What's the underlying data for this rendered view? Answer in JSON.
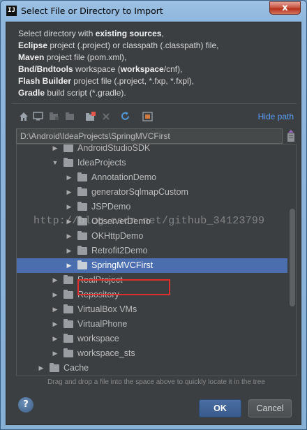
{
  "window": {
    "title": "Select File or Directory to Import",
    "app_icon_text": "IJ",
    "close_symbol": "x"
  },
  "description": {
    "lines": [
      {
        "parts": [
          {
            "t": "Select directory with ",
            "b": false
          },
          {
            "t": "existing sources",
            "b": true
          },
          {
            "t": ",",
            "b": false
          }
        ]
      },
      {
        "parts": [
          {
            "t": "Eclipse",
            "b": true
          },
          {
            "t": " project (.project) or classpath (.classpath) file,",
            "b": false
          }
        ]
      },
      {
        "parts": [
          {
            "t": "Maven",
            "b": true
          },
          {
            "t": " project file (pom.xml),",
            "b": false
          }
        ]
      },
      {
        "parts": [
          {
            "t": "Bnd/Bndtools",
            "b": true
          },
          {
            "t": " workspace (",
            "b": false
          },
          {
            "t": "workspace",
            "b": true
          },
          {
            "t": "/cnf),",
            "b": false
          }
        ]
      },
      {
        "parts": [
          {
            "t": "Flash Builder",
            "b": true
          },
          {
            "t": " project file (.project, *.fxp, *.fxpl),",
            "b": false
          }
        ]
      },
      {
        "parts": [
          {
            "t": "Gradle",
            "b": true
          },
          {
            "t": " build script (*.gradle).",
            "b": false
          }
        ]
      }
    ]
  },
  "toolbar": {
    "icons": [
      "home-icon",
      "desktop-icon",
      "project-icon",
      "module-icon",
      "new-folder-icon",
      "delete-icon",
      "refresh-icon",
      "show-hidden-icon"
    ],
    "hide_path_label": "Hide path"
  },
  "path": {
    "value": "D:\\Android\\IdeaProjects\\SpringMVCFirst"
  },
  "tree": {
    "items": [
      {
        "label": "AndroidStudioSDK",
        "depth": 1,
        "expanded": false,
        "selected": false
      },
      {
        "label": "IdeaProjects",
        "depth": 1,
        "expanded": true,
        "selected": false
      },
      {
        "label": "AnnotationDemo",
        "depth": 2,
        "expanded": false,
        "selected": false
      },
      {
        "label": "generatorSqlmapCustom",
        "depth": 2,
        "expanded": false,
        "selected": false
      },
      {
        "label": "JSPDemo",
        "depth": 2,
        "expanded": false,
        "selected": false
      },
      {
        "label": "ObserverDemo",
        "depth": 2,
        "expanded": false,
        "selected": false
      },
      {
        "label": "OKHttpDemo",
        "depth": 2,
        "expanded": false,
        "selected": false
      },
      {
        "label": "Retrofit2Demo",
        "depth": 2,
        "expanded": false,
        "selected": false
      },
      {
        "label": "SpringMVCFirst",
        "depth": 2,
        "expanded": false,
        "selected": true
      },
      {
        "label": "RealProject",
        "depth": 1,
        "expanded": false,
        "selected": false
      },
      {
        "label": "Repository",
        "depth": 1,
        "expanded": false,
        "selected": false
      },
      {
        "label": "VirtualBox VMs",
        "depth": 1,
        "expanded": false,
        "selected": false
      },
      {
        "label": "VirtualPhone",
        "depth": 1,
        "expanded": false,
        "selected": false
      },
      {
        "label": "workspace",
        "depth": 1,
        "expanded": false,
        "selected": false
      },
      {
        "label": "workspace_sts",
        "depth": 1,
        "expanded": false,
        "selected": false
      },
      {
        "label": "Cache",
        "depth": 0,
        "expanded": false,
        "selected": false
      }
    ]
  },
  "hint": "Drag and drop a file into the space above to quickly locate it in the tree",
  "buttons": {
    "help": "?",
    "ok": "OK",
    "cancel": "Cancel"
  },
  "watermark": "http://blog.csdn.net/github_34123799",
  "colors": {
    "selection": "#4b6eaf",
    "highlight_box": "#e0302b",
    "link": "#589df6"
  }
}
